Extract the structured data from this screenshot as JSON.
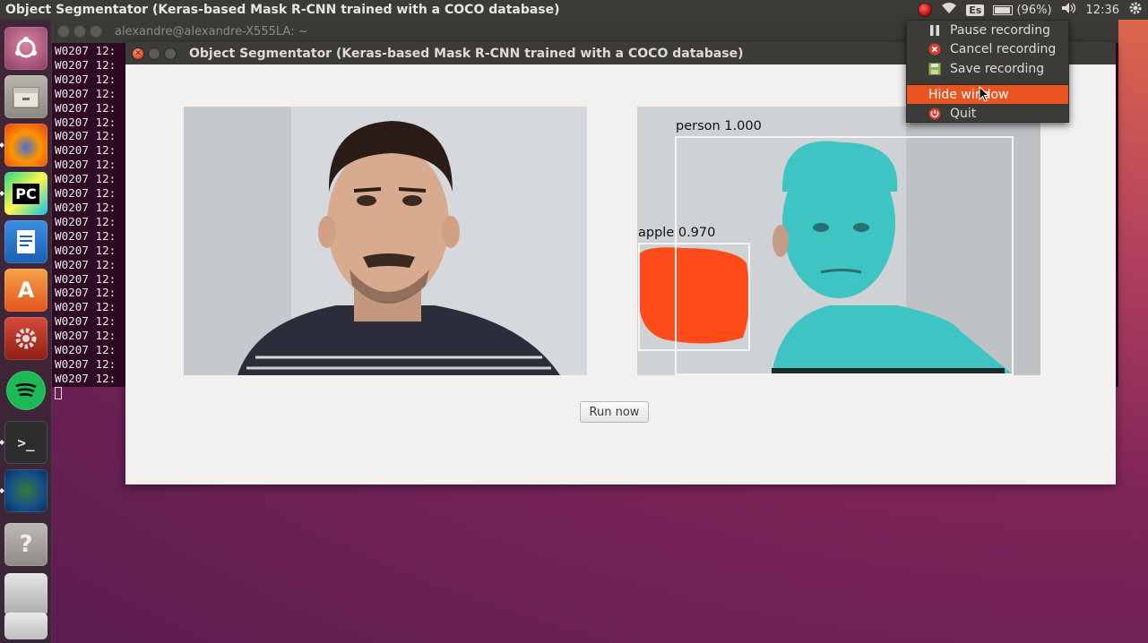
{
  "top_panel": {
    "title": "Object Segmentator (Keras-based Mask R-CNN trained with a COCO database)",
    "keyboard_layout": "Es",
    "battery": "(96%)",
    "time": "12:36"
  },
  "terminal": {
    "title": "alexandre@alexandre-X555LA: ~",
    "lines": [
      "W0207 12:",
      "W0207 12:",
      "W0207 12:",
      "W0207 12:",
      "W0207 12:",
      "W0207 12:",
      "W0207 12:",
      "W0207 12:",
      "W0207 12:",
      "W0207 12:",
      "W0207 12:",
      "W0207 12:",
      "W0207 12:",
      "W0207 12:",
      "W0207 12:",
      "W0207 12:",
      "W0207 12:",
      "W0207 12:",
      "W0207 12:",
      "W0207 12:",
      "W0207 12:",
      "W0207 12:",
      "W0207 12:",
      "W0207 12:"
    ]
  },
  "app": {
    "title": "Object Segmentator (Keras-based Mask R-CNN trained with a COCO database)",
    "run_button": "Run now",
    "detections": [
      {
        "label": "person 1.000"
      },
      {
        "label": "apple 0.970"
      }
    ]
  },
  "menu": {
    "items": [
      {
        "label": "Pause recording",
        "icon": "pause-icon"
      },
      {
        "label": "Cancel recording",
        "icon": "cancel-icon"
      },
      {
        "label": "Save recording",
        "icon": "save-icon"
      },
      {
        "label": "Hide window",
        "icon": ""
      },
      {
        "label": "Quit",
        "icon": "power-icon"
      }
    ]
  },
  "colors": {
    "accent": "#e95420",
    "panel": "#3c3b37",
    "mask_person": "#3fc4c4",
    "mask_apple": "#ff4a1a",
    "terminal_bg": "#300a24"
  }
}
